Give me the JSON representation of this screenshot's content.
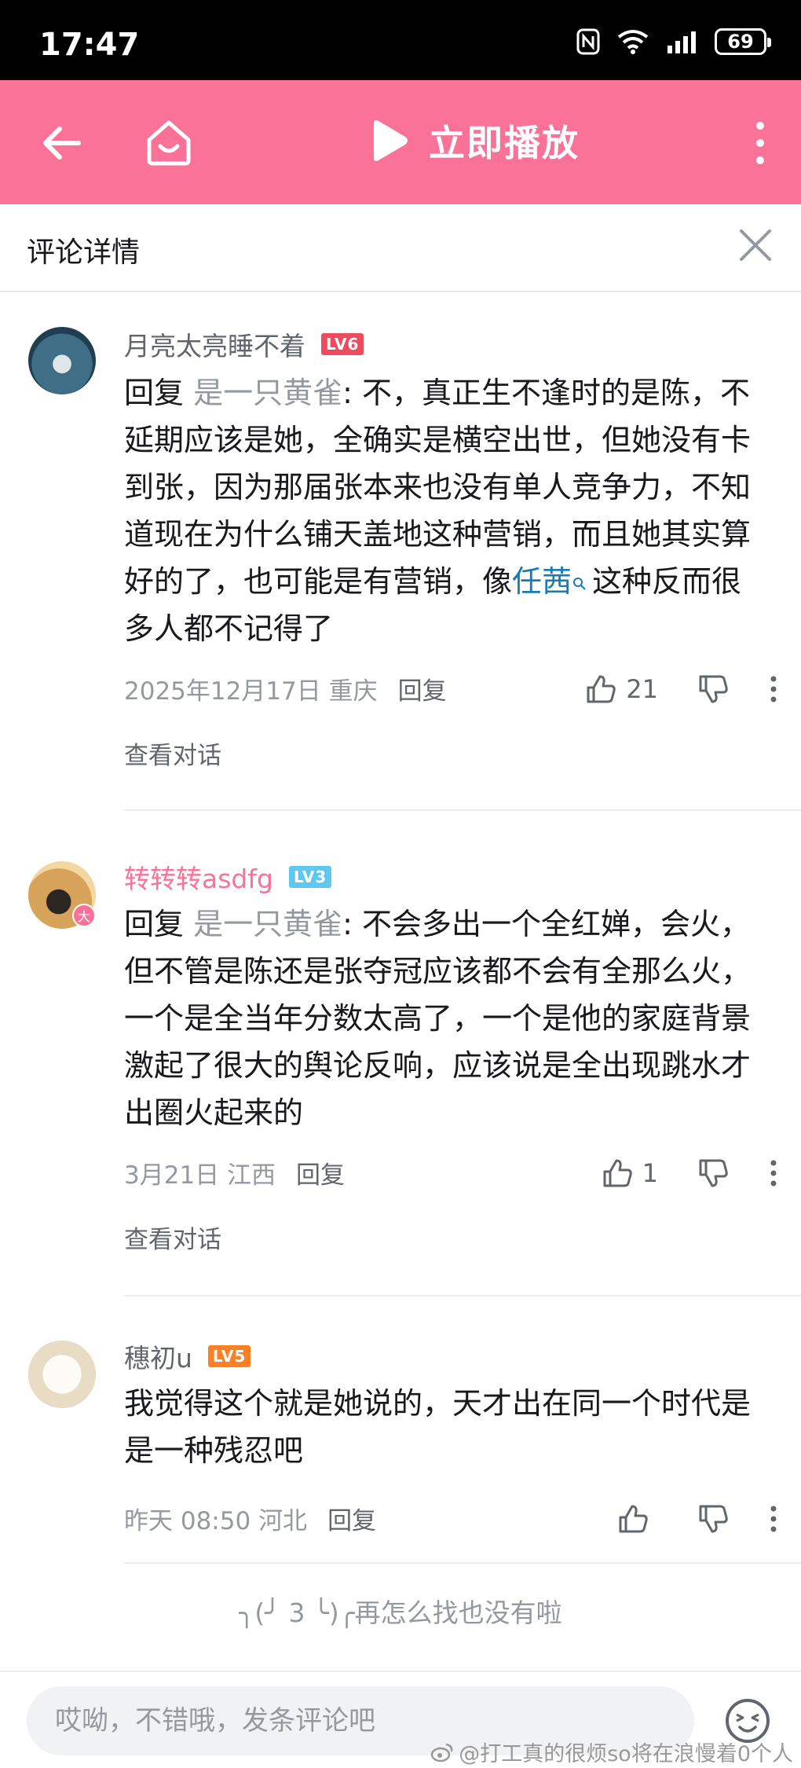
{
  "status_bar": {
    "time": "17:47",
    "battery": "69"
  },
  "nav": {
    "play_label": "立即播放"
  },
  "header": {
    "title": "评论详情"
  },
  "comments": [
    {
      "username": "月亮太亮睡不着",
      "level": "LV6",
      "level_color": "#ee4b5e",
      "reply_prefix": "回复 ",
      "reply_to": "是一只黄雀",
      "text_before": ": 不，真正生不逢时的是陈，不延期应该是她，全确实是横空出世，但她没有卡到张，因为那届张本来也没有单人竞争力，不知道现在为什么铺天盖地这种营销，而且她其实算好的了，也可能是有营销，像",
      "keyword": "任茜",
      "text_after": "这种反而很多人都不记得了",
      "date": "2025年12月17日",
      "location": "重庆",
      "reply_label": "回复",
      "likes": "21",
      "view_conversation": "查看对话"
    },
    {
      "username": "转转转asdfg",
      "level": "LV3",
      "level_color": "#5ec9f0",
      "vip": "大",
      "reply_prefix": "回复 ",
      "reply_to": "是一只黄雀",
      "text": ": 不会多出一个全红婵，会火，但不管是陈还是张夺冠应该都不会有全那么火，一个是全当年分数太高了，一个是他的家庭背景激起了很大的舆论反响，应该说是全出现跳水才出圈火起来的",
      "date": "3月21日",
      "location": "江西",
      "reply_label": "回复",
      "likes": "1",
      "view_conversation": "查看对话"
    },
    {
      "username": "穗初u",
      "level": "LV5",
      "level_color": "#ff7f24",
      "text": "我觉得这个就是她说的，天才出在同一个时代是是一种残忍吧",
      "date": "昨天 08:50",
      "location": "河北",
      "reply_label": "回复",
      "likes": ""
    }
  ],
  "end_note": "╮(╯ 3 ╰)╭再怎么找也没有啦",
  "bottom": {
    "input_placeholder": "哎呦，不错哦，发条评论吧",
    "watermark": "@打工真的很烦so将在浪慢着0个人"
  },
  "colors": {
    "brand_pink": "#fb7299",
    "link_blue": "#177bb5"
  },
  "icons": [
    "back-arrow-icon",
    "home-icon",
    "play-icon",
    "more-vertical-icon",
    "close-icon",
    "thumb-up-icon",
    "thumb-down-icon",
    "search-small-icon",
    "emoji-icon",
    "weibo-icon"
  ]
}
